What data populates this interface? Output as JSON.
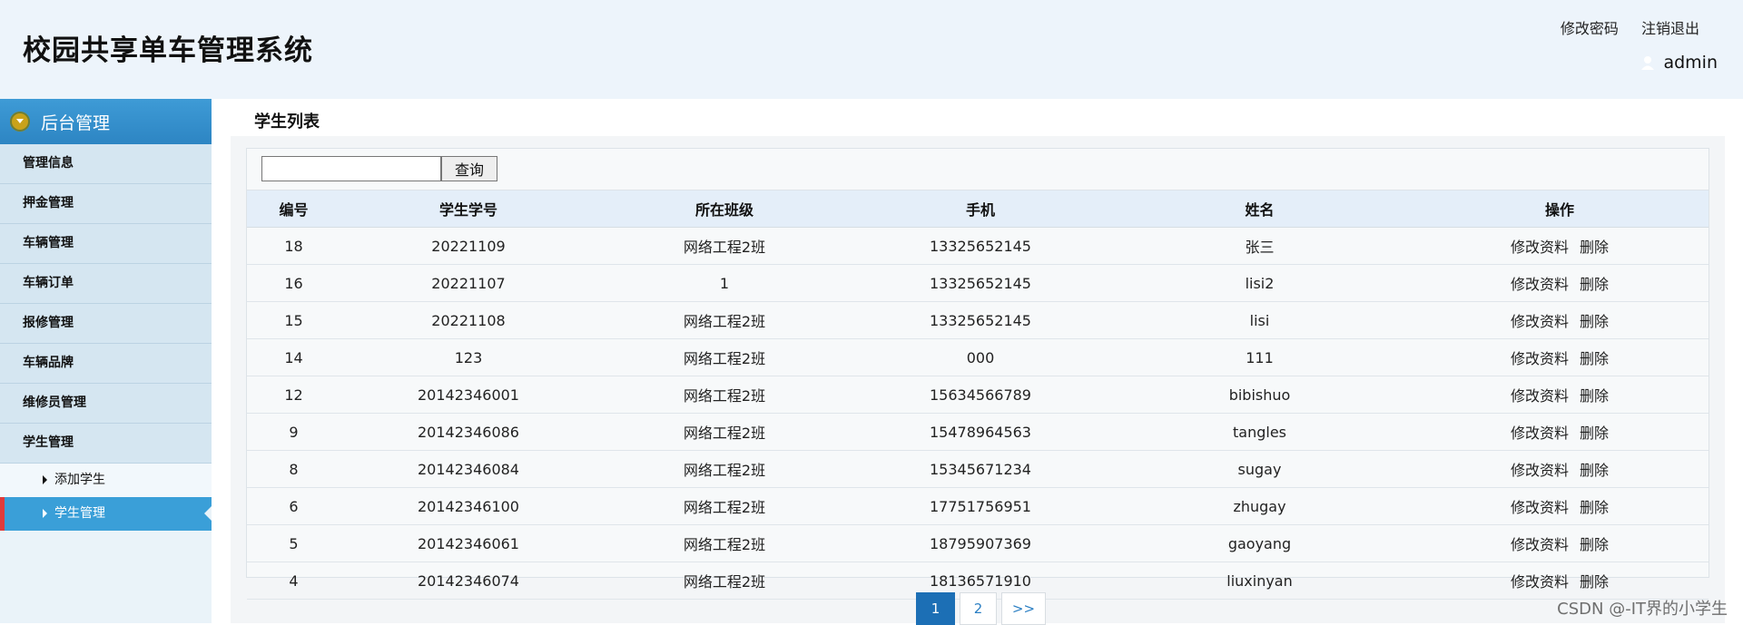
{
  "header": {
    "title": "校园共享单车管理系统",
    "links": [
      "修改密码",
      "注销退出"
    ],
    "username": "admin"
  },
  "sidebar": {
    "section_title": "后台管理",
    "items": [
      "管理信息",
      "押金管理",
      "车辆管理",
      "车辆订单",
      "报修管理",
      "车辆品牌",
      "维修员管理",
      "学生管理"
    ],
    "subitems": [
      "添加学生",
      "学生管理"
    ],
    "active_subitem": "学生管理"
  },
  "main": {
    "title": "学生列表",
    "search": {
      "value": "",
      "button": "查询"
    },
    "columns": [
      "编号",
      "学生学号",
      "所在班级",
      "手机",
      "姓名",
      "操作"
    ],
    "rows": [
      [
        "18",
        "20221109",
        "网络工程2班",
        "13325652145",
        "张三"
      ],
      [
        "16",
        "20221107",
        "1",
        "13325652145",
        "lisi2"
      ],
      [
        "15",
        "20221108",
        "网络工程2班",
        "13325652145",
        "lisi"
      ],
      [
        "14",
        "123",
        "网络工程2班",
        "000",
        "111"
      ],
      [
        "12",
        "20142346001",
        "网络工程2班",
        "15634566789",
        "bibishuo"
      ],
      [
        "9",
        "20142346086",
        "网络工程2班",
        "15478964563",
        "tangles"
      ],
      [
        "8",
        "20142346084",
        "网络工程2班",
        "15345671234",
        "sugay"
      ],
      [
        "6",
        "20142346100",
        "网络工程2班",
        "17751756951",
        "zhugay"
      ],
      [
        "5",
        "20142346061",
        "网络工程2班",
        "18795907369",
        "gaoyang"
      ],
      [
        "4",
        "20142346074",
        "网络工程2班",
        "18136571910",
        "liuxinyan"
      ]
    ],
    "row_actions": [
      "修改资料",
      "删除"
    ],
    "pagination": {
      "current": "1",
      "pages": [
        "2"
      ],
      "next": ">>"
    }
  },
  "watermark": "CSDN @-IT界的小学生",
  "colors": {
    "header_bg": "#edf4fb",
    "sidebar_head": "#2d85c3",
    "active_item": "#3a9fd8",
    "pager_active": "#1c6fb5"
  }
}
